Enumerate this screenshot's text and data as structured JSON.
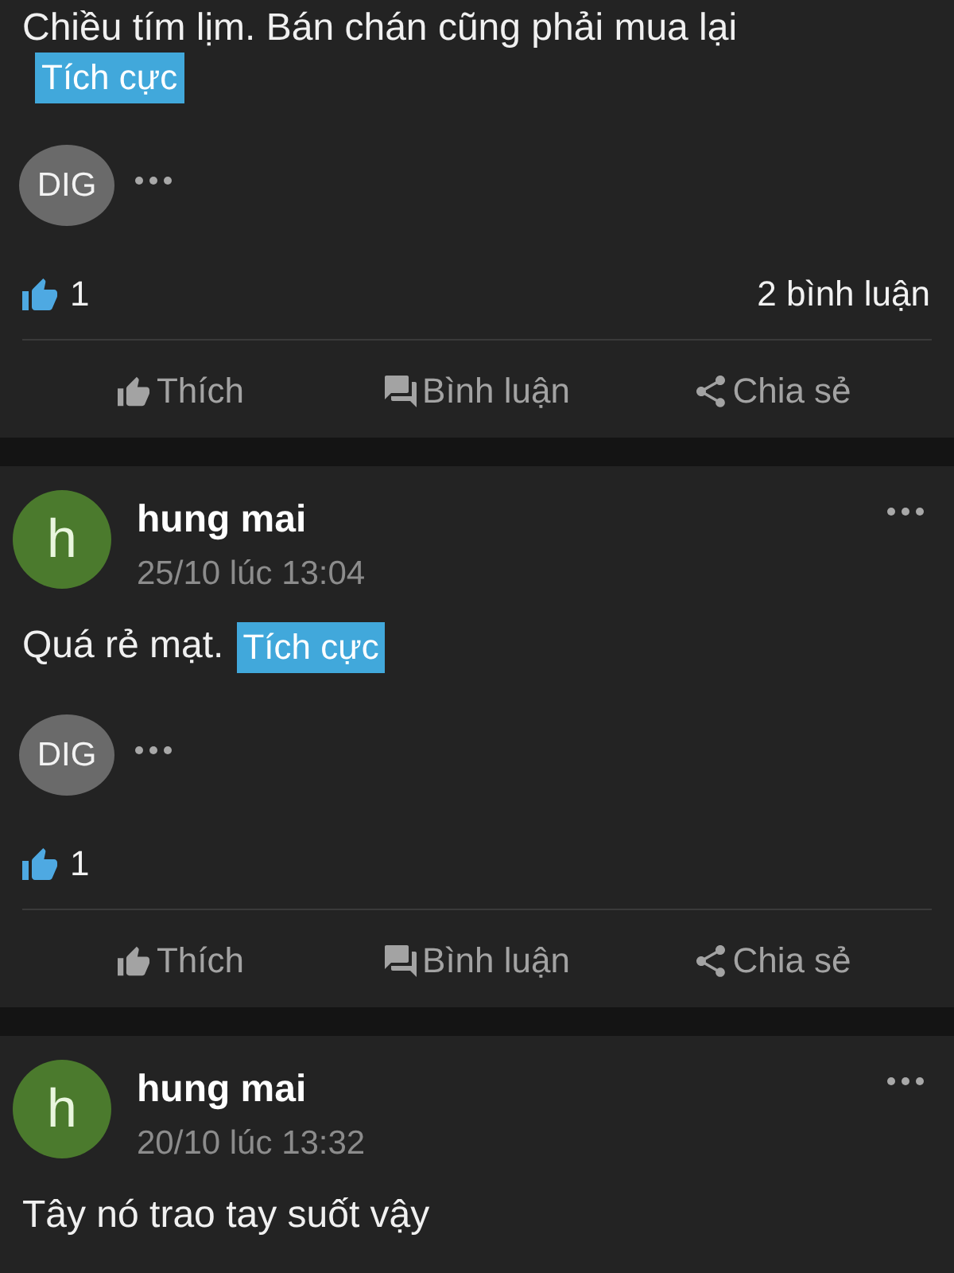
{
  "posts": [
    {
      "text": "Chiều tím lịm. Bán chán cũng phải mua lại",
      "tag": "Tích cực",
      "chip": "DIG",
      "likes": "1",
      "comments": "2 bình luận",
      "actions": [
        {
          "kind": "like",
          "label": "Thích"
        },
        {
          "kind": "comment",
          "label": "Bình luận"
        },
        {
          "kind": "share",
          "label": "Chia sẻ"
        }
      ]
    },
    {
      "author": {
        "initial": "h",
        "name": "hung mai"
      },
      "time": "25/10 lúc 13:04",
      "text": "Quá rẻ mạt.",
      "tag": "Tích cực",
      "chip": "DIG",
      "likes": "1",
      "actions": [
        {
          "kind": "like",
          "label": "Thích"
        },
        {
          "kind": "comment",
          "label": "Bình luận"
        },
        {
          "kind": "share",
          "label": "Chia sẻ"
        }
      ]
    },
    {
      "author": {
        "initial": "h",
        "name": "hung mai"
      },
      "time": "20/10 lúc 13:32",
      "text": "Tây nó trao tay suốt vậy"
    }
  ]
}
